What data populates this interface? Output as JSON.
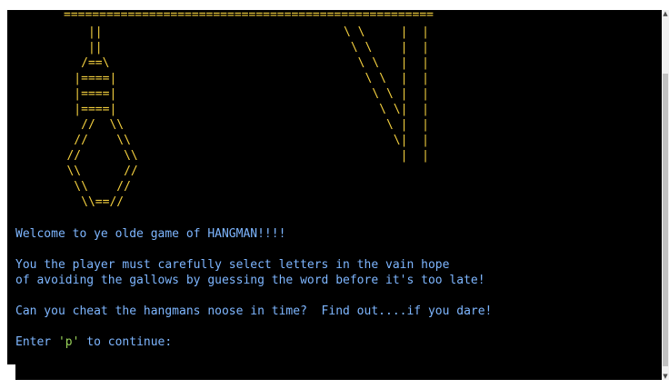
{
  "terminal": {
    "art": {
      "beam": "====================================================",
      "noose": "      ||\n      ||\n     /==\\\n    |====|\n    |====|\n    |====|\n     //  \\\\\n    //    \\\\\n   //      \\\\\n   \\\\      //\n    \\\\    //\n     \\\\==//",
      "post": "\\ \\     |  |\n \\ \\    |  |\n  \\ \\   |  |\n   \\ \\  |  |\n    \\ \\ |  |\n     \\ \\|  |\n      \\ |  |\n       \\|  |\n        |  |"
    },
    "lines": {
      "welcome": "Welcome to ye olde game of HANGMAN!!!!",
      "rules_1": "You the player must carefully select letters in the vain hope",
      "rules_2": "of avoiding the gallows by guessing the word before it's too late!",
      "challenge": "Can you cheat the hangmans noose in time?  Find out....if you dare!",
      "prompt_before": "Enter ",
      "prompt_key": "'p'",
      "prompt_after": " to continue:"
    }
  },
  "scrollbar": {
    "up_icon": "▲",
    "down_icon": "▼"
  },
  "colors": {
    "background": "#000000",
    "art": "#f4d03f",
    "text": "#7eb6ff",
    "highlight": "#9ad45a"
  }
}
